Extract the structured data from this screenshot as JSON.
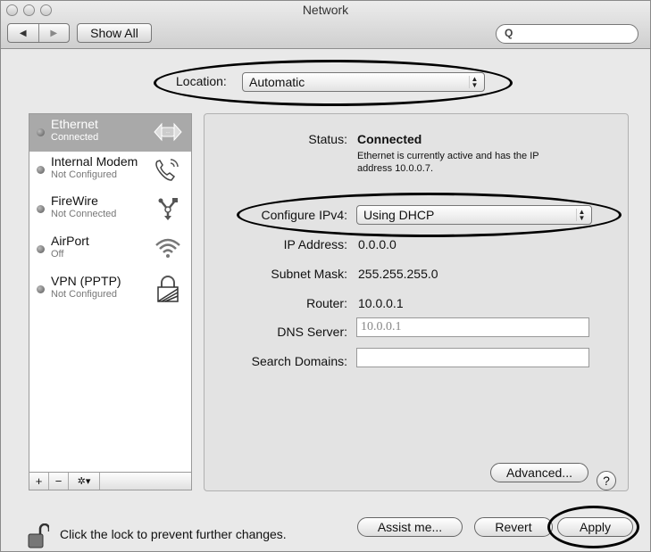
{
  "window": {
    "title": "Network"
  },
  "toolbar": {
    "back_icon": "◀",
    "forward_icon": "▶",
    "show_all_label": "Show All",
    "search_icon": "Q",
    "search_value": ""
  },
  "location": {
    "label": "Location:",
    "value": "Automatic"
  },
  "services": [
    {
      "name": "Ethernet",
      "status": "Connected",
      "icon": "ethernet-icon"
    },
    {
      "name": "Internal Modem",
      "status": "Not Configured",
      "icon": "phone-icon"
    },
    {
      "name": "FireWire",
      "status": "Not Connected",
      "icon": "firewire-icon"
    },
    {
      "name": "AirPort",
      "status": "Off",
      "icon": "wifi-icon"
    },
    {
      "name": "VPN (PPTP)",
      "status": "Not Configured",
      "icon": "lock-icon"
    }
  ],
  "sidebar_bar": {
    "add": "+",
    "remove": "−",
    "action": "✲▾"
  },
  "detail": {
    "status_label": "Status:",
    "status_value": "Connected",
    "status_desc_1": "Ethernet is currently active and has the IP",
    "status_desc_2": "address 10.0.0.7.",
    "configure_label": "Configure IPv4:",
    "configure_value": "Using DHCP",
    "ip_label": "IP Address:",
    "ip_value": "0.0.0.0",
    "subnet_label": "Subnet Mask:",
    "subnet_value": "255.255.255.0",
    "router_label": "Router:",
    "router_value": "10.0.0.1",
    "dns_label": "DNS Server:",
    "dns_value": "10.0.0.1",
    "search_label": "Search Domains:",
    "search_value": "",
    "advanced_label": "Advanced...",
    "help_label": "?"
  },
  "footer": {
    "lock_text": "Click the lock to prevent further changes.",
    "assist_label": "Assist me...",
    "revert_label": "Revert",
    "apply_label": "Apply"
  }
}
